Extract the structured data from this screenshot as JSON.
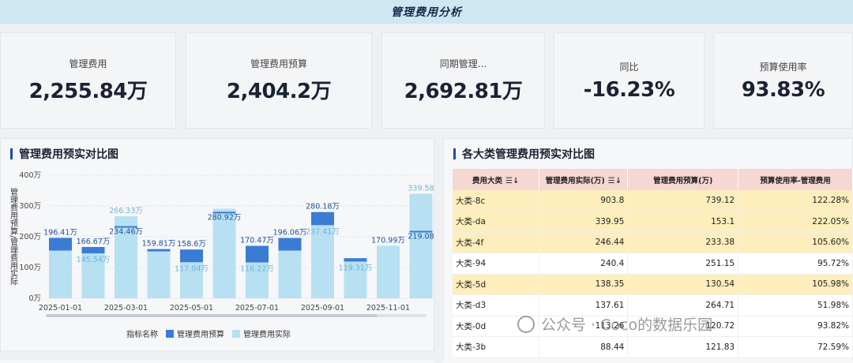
{
  "header": {
    "title": "管理费用分析"
  },
  "kpis": [
    {
      "label": "管理费用",
      "value": "2,255.84万"
    },
    {
      "label": "管理费用预算",
      "value": "2,404.2万"
    },
    {
      "label": "同期管理...",
      "value": "2,692.81万"
    },
    {
      "label": "同比",
      "value": "-16.23%"
    },
    {
      "label": "预算使用率",
      "value": "93.83%"
    }
  ],
  "left_panel": {
    "title": "管理费用预实对比图",
    "legend_title": "指标名称",
    "legend": [
      {
        "name": "管理费用预算",
        "color": "#3a7bd5"
      },
      {
        "name": "管理费用实际",
        "color": "#b7e0f2"
      }
    ]
  },
  "chart_data": {
    "type": "bar",
    "ylabel": "管理费用预算/管理费用实际",
    "ylim": [
      0,
      400
    ],
    "yticks": [
      "0万",
      "100万",
      "200万",
      "300万",
      "400万"
    ],
    "x_tick_labels": [
      "2025-01-01",
      "2025-03-01",
      "2025-05-01",
      "2025-07-01",
      "2025-09-01",
      "2025-11-01"
    ],
    "series": [
      {
        "name": "管理费用预算",
        "color": "#3a7bd5",
        "values": [
          196.41,
          166.67,
          234.46,
          159.81,
          158.6,
          280.92,
          170.47,
          196.06,
          280.18,
          130.31,
          170.99,
          219.08
        ],
        "labels": [
          "196.41万",
          "166.67万",
          "234.46万",
          "159.81万",
          "158.6万",
          "280.92万",
          "170.47万",
          "196.06万",
          "280.18万",
          "",
          "170.99万",
          "219.08"
        ]
      },
      {
        "name": "管理费用实际",
        "color": "#b7e0f2",
        "values": [
          155.0,
          145.54,
          266.33,
          152.0,
          117.04,
          291.0,
          116.22,
          155.0,
          237.41,
          119.31,
          170.99,
          339.58
        ],
        "labels": [
          "",
          "145.54万",
          "266.33万",
          "",
          "117.04万",
          "",
          "116.22万",
          "",
          "237.41万",
          "119.31万",
          "",
          "339.58"
        ]
      }
    ]
  },
  "right_panel": {
    "title": "各大类管理费用预实对比图",
    "columns": [
      "费用大类",
      "管理费用实际(万)",
      "管理费用预算(万)",
      "预算使用率-管理费用"
    ],
    "rows": [
      {
        "name": "大类-8c",
        "actual": "903.8",
        "budget": "739.12",
        "rate": "122.28%",
        "hl": true
      },
      {
        "name": "大类-da",
        "actual": "339.95",
        "budget": "153.1",
        "rate": "222.05%",
        "hl": true
      },
      {
        "name": "大类-4f",
        "actual": "246.44",
        "budget": "233.38",
        "rate": "105.60%",
        "hl": true
      },
      {
        "name": "大类-94",
        "actual": "240.4",
        "budget": "251.15",
        "rate": "95.72%",
        "hl": false
      },
      {
        "name": "大类-5d",
        "actual": "138.35",
        "budget": "130.54",
        "rate": "105.98%",
        "hl": true
      },
      {
        "name": "大类-d3",
        "actual": "137.61",
        "budget": "264.71",
        "rate": "51.98%",
        "hl": false
      },
      {
        "name": "大类-0d",
        "actual": "113.26",
        "budget": "120.72",
        "rate": "93.82%",
        "hl": false
      },
      {
        "name": "大类-3b",
        "actual": "88.44",
        "budget": "121.83",
        "rate": "72.59%",
        "hl": false
      }
    ]
  },
  "watermark": "公众号 · Coco的数据乐园"
}
